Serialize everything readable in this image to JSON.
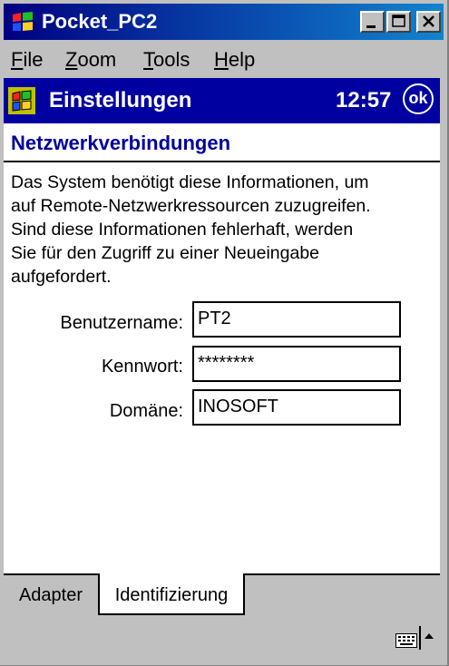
{
  "window": {
    "title": "Pocket_PC2",
    "controls": [
      "minimize",
      "maximize",
      "close"
    ]
  },
  "menu": {
    "items": [
      {
        "mnemonic": "F",
        "rest": "ile"
      },
      {
        "mnemonic": "Z",
        "rest": "oom"
      },
      {
        "mnemonic": "T",
        "rest": "ools"
      },
      {
        "mnemonic": "H",
        "rest": "elp"
      }
    ]
  },
  "navbar": {
    "title": "Einstellungen",
    "time": "12:57",
    "ok_label": "ok"
  },
  "page": {
    "heading": "Netzwerkverbindungen",
    "info_lines": [
      "Das System benötigt diese Informationen, um",
      "auf Remote-Netzwerkressourcen zuzugreifen.",
      "Sind diese Informationen fehlerhaft, werden",
      "Sie für den Zugriff zu einer Neueingabe",
      "aufgefordert."
    ]
  },
  "form": {
    "username": {
      "label": "Benutzername:",
      "value": "PT2"
    },
    "password": {
      "label": "Kennwort:",
      "value": "********"
    },
    "domain": {
      "label": "Domäne:",
      "value": "INOSOFT"
    }
  },
  "tabs": [
    {
      "label": "Adapter",
      "selected": false
    },
    {
      "label": "Identifizierung",
      "selected": true
    }
  ],
  "colors": {
    "title_gradient_start": "#000080",
    "title_gradient_end": "#1084d0",
    "nav_bar": "#0000a0",
    "heading_text": "#0000a0",
    "chrome": "#c0c0c0"
  },
  "icons": {
    "app": "windows-flag-icon",
    "start": "windows-start-icon",
    "ok": "ok-circle-icon",
    "sip": "keyboard-icon",
    "sip_toggle": "arrow-up-icon"
  }
}
